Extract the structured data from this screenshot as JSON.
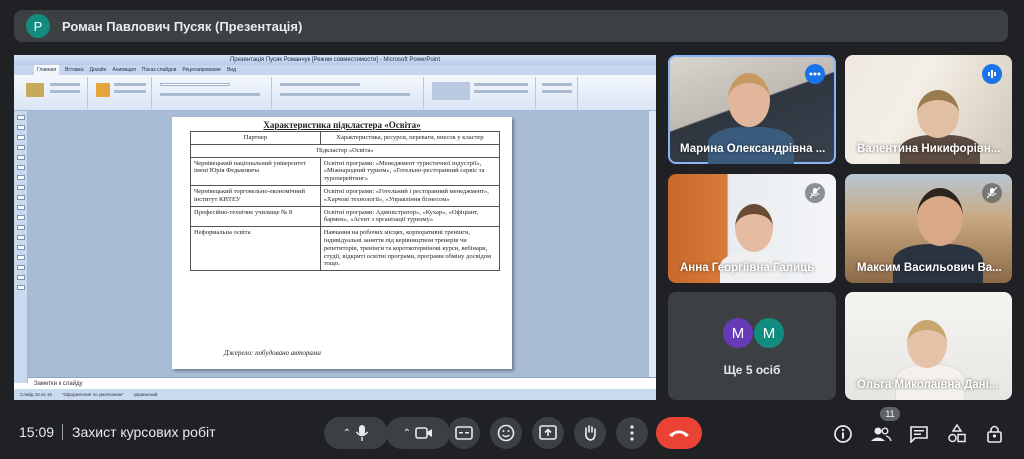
{
  "presenter_bar": {
    "avatar_letter": "Р",
    "title": "Роман Павлович Пусяк (Презентація)"
  },
  "ppt": {
    "window_title": "Презентація Пусяк Романчук [Режим совместимости] - Microsoft PowerPoint",
    "tabs": [
      "Главная",
      "Вставка",
      "Дизайн",
      "Анимация",
      "Показ слайдов",
      "Рецензирование",
      "Вид"
    ],
    "notes_placeholder": "Заметки к слайду",
    "status": [
      "Слайд 15 из 15",
      "\"Оформление по умолчанию\"",
      "украинский"
    ],
    "slide": {
      "title": "Характеристика підкластера «Освіта»",
      "headers": [
        "Партнер",
        "Характеристика, ресурси, переваги, внесок у кластер"
      ],
      "subheader": "Підкластер «Освіта»",
      "rows": [
        [
          "Чернівецький національний університет імені Юрія Федьковича",
          "Освітні програми: «Менеджмент туристичної індустрії», «Міжнародний туризм», «Готельно-ресторанний сервіс та туроперейтинг»"
        ],
        [
          "Чернівецький торговельно-економічний інститут КНТЕУ",
          "Освітні програми: «Готельний і ресторанний менеджмент», «Харчові технології», «Управління бізнесом»"
        ],
        [
          "Професійно-технічне училище № 8",
          "Освітні програми: Адміністратор», «Кухар», «Офіціант, бармен», «Агент з організації туризму»"
        ],
        [
          "Неформальна освіта",
          "Навчання на робочих місцях, корпоративні тренінги, індивідуальні заняття під керівництвом тренерів чи репетиторів, тренінги та короткотермінові курси, вебінари, студії, відкриті освітні програми, програми обміну досвідом тощо."
        ]
      ],
      "source": "Джерело: побудовано авторами"
    }
  },
  "participants": [
    {
      "name": "Марина Олександрівна ..."
    },
    {
      "name": "Валентина Никифорівн..."
    },
    {
      "name": "Анна Георгіївна Галиць"
    },
    {
      "name": "Максим Васильович Ва..."
    },
    {
      "name": "Ольга Миколаївна Дані..."
    }
  ],
  "more_tile": {
    "avatars": [
      "М",
      "М"
    ],
    "avatar_colors": [
      "#673ab7",
      "#128c7e"
    ],
    "label": "Ще 5 осіб"
  },
  "bottom_bar": {
    "time": "15:09",
    "meeting_name": "Захист курсових робіт",
    "people_count": "11"
  },
  "colors": {
    "end_call": "#ea4335",
    "accent": "#1a73e8",
    "bar_bg": "#3c4043"
  }
}
